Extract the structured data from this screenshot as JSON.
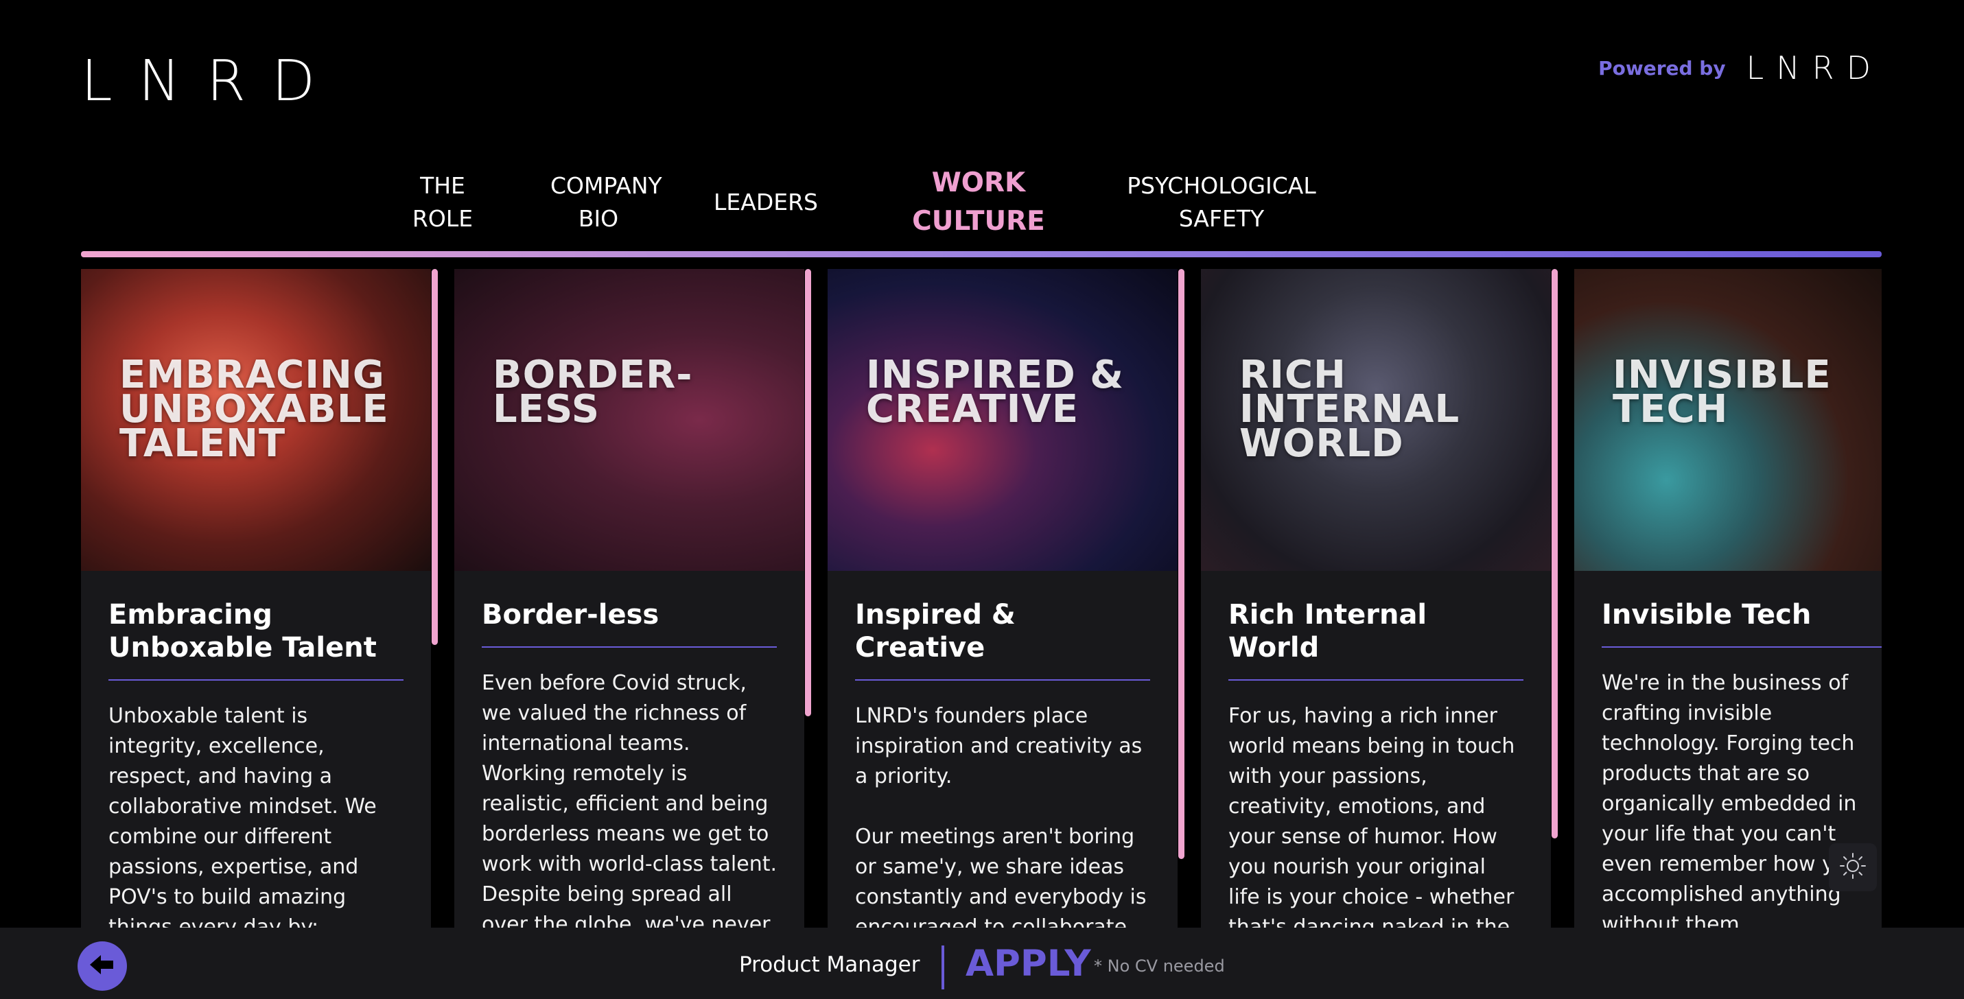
{
  "brand": {
    "logo_text": "LNRD",
    "powered_by": "Powered by",
    "powered_logo": "LNRD"
  },
  "nav": {
    "tabs": [
      {
        "label": "THE\nROLE",
        "active": false
      },
      {
        "label": "COMPANY\nBIO",
        "active": false
      },
      {
        "label": "LEADERS",
        "active": false
      },
      {
        "label": "WORK\nCULTURE",
        "active": true
      },
      {
        "label": "PSYCHOLOGICAL\nSAFETY",
        "active": false
      }
    ]
  },
  "cards": [
    {
      "image_title": "EMBRACING\nUNBOXABLE\nTALENT",
      "title": "Embracing Unboxable Talent",
      "text": "Unboxable talent is integrity, excellence, respect, and having a collaborative mindset. We combine our different passions, expertise, and POV's to build amazing things every day by:"
    },
    {
      "image_title": "BORDER-\nLESS",
      "title": "Border-less",
      "text": "Even before Covid struck, we valued the richness of international teams. Working remotely is realistic, efficient and being borderless means we get to work with world-class talent. Despite being spread all over the globe, we've never"
    },
    {
      "image_title": "INSPIRED &\nCREATIVE",
      "title": "Inspired & Creative",
      "text": "LNRD's founders place inspiration and creativity as a priority.\n\nOur meetings aren't boring or same'y, we share ideas constantly and everybody is encouraged to collaborate. We're allowed space to"
    },
    {
      "image_title": "RICH\nINTERNAL\nWORLD",
      "title": "Rich Internal World",
      "text": "For us, having a rich inner world means being in touch with your passions, creativity, emotions, and your sense of humor. How you nourish your original life is your choice - whether that's dancing naked in the rain or eating only blue"
    },
    {
      "image_title": "INVISIBLE\nTECH",
      "title": "Invisible Tech",
      "text": "We're in the business of crafting invisible technology. Forging tech products that are so organically embedded in your life that you can't even remember how you accomplished anything without them."
    }
  ],
  "footer": {
    "role": "Product Manager",
    "apply": "APPLY",
    "cv_note": "* No CV needed"
  },
  "colors": {
    "accent_purple": "#6a5bd8",
    "accent_pink": "#f0a4cf",
    "card_bg": "#18181b"
  },
  "icons": {
    "back": "arrow-left-icon",
    "theme": "sun-icon"
  }
}
